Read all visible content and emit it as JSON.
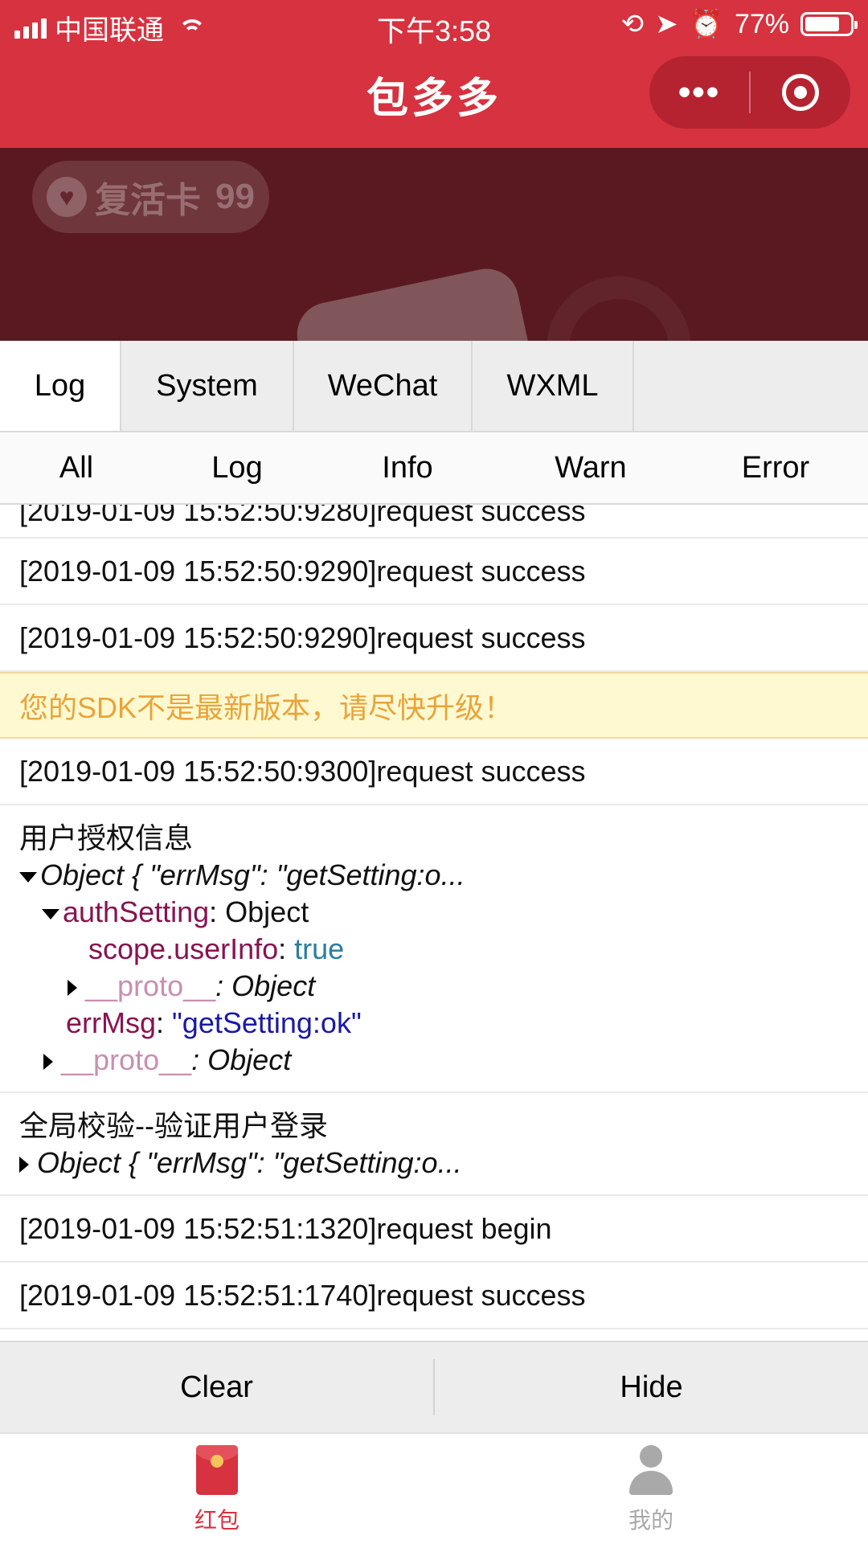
{
  "status_bar": {
    "carrier": "中国联通",
    "time": "下午3:58",
    "battery": "77%",
    "battery_level": 0.77
  },
  "nav": {
    "title": "包多多",
    "menu_icon": "more-dots-icon",
    "close_icon": "target-circle-icon"
  },
  "game": {
    "revive_label": "复活卡",
    "revive_count": "99"
  },
  "console": {
    "tabs": [
      "Log",
      "System",
      "WeChat",
      "WXML"
    ],
    "active_tab": "Log",
    "subtabs": [
      "All",
      "Log",
      "Info",
      "Warn",
      "Error"
    ],
    "logs": {
      "partial": "[2019-01-09 15:52:50:9280]request success",
      "r1": "[2019-01-09 15:52:50:9290]request success",
      "r2": "[2019-01-09 15:52:50:9290]request success",
      "warn": "您的SDK不是最新版本，请尽快升级！",
      "r3": "[2019-01-09 15:52:50:9300]request success",
      "auth": {
        "title": "用户授权信息",
        "object_summary": "Object { \"errMsg\": \"getSetting:o...",
        "authSetting_key": "authSetting",
        "authSetting_val": ": Object",
        "scope_key": "scope.userInfo",
        "scope_val": "true",
        "proto_key": "__proto__",
        "proto_val": ": Object",
        "errMsg_key": "errMsg",
        "errMsg_val": "\"getSetting:ok\"",
        "proto2_key": "__proto__",
        "proto2_val": ": Object"
      },
      "global": {
        "title": "全局校验--验证用户登录",
        "object_summary": "Object { \"errMsg\": \"getSetting:o..."
      },
      "r4": "[2019-01-09 15:52:51:1320]request begin",
      "r5": "[2019-01-09 15:52:51:1740]request success"
    },
    "clear_label": "Clear",
    "hide_label": "Hide"
  },
  "tabbar": {
    "items": [
      {
        "label": "红包",
        "icon": "red-packet-icon",
        "color": "#d6323f"
      },
      {
        "label": "我的",
        "icon": "user-icon",
        "color": "#a9a9a9"
      }
    ]
  },
  "colors": {
    "brand_red": "#d6323f",
    "warn_text": "#e8a43a",
    "warn_bg": "#fff9d2"
  }
}
